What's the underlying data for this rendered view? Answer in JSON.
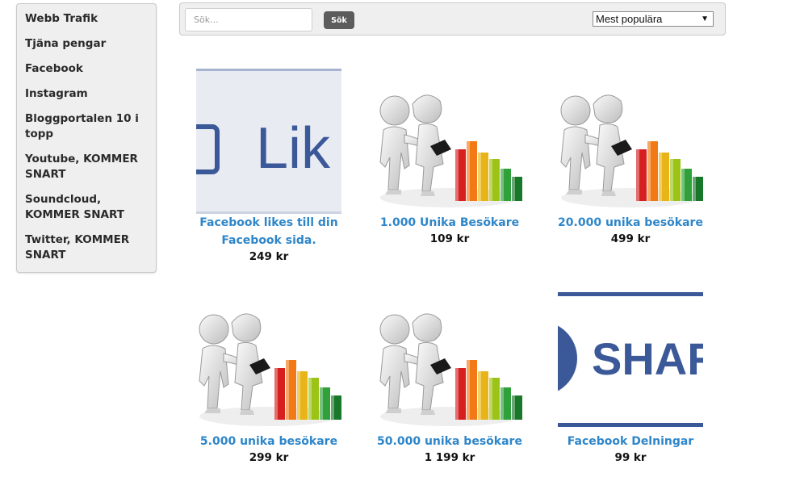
{
  "sidebar": {
    "items": [
      {
        "label": "Webb Trafik"
      },
      {
        "label": "Tjäna pengar"
      },
      {
        "label": "Facebook"
      },
      {
        "label": "Instagram"
      },
      {
        "label": "Bloggportalen 10 i topp"
      },
      {
        "label": "Youtube, KOMMER SNART"
      },
      {
        "label": "Soundcloud, KOMMER SNART"
      },
      {
        "label": "Twitter, KOMMER SNART"
      }
    ]
  },
  "search": {
    "placeholder": "Sök...",
    "value": "",
    "button_label": "Sök"
  },
  "sort": {
    "selected": "Mest populära"
  },
  "colors": {
    "link": "#2e86c9",
    "facebook_blue": "#3b5998",
    "button_dark": "#5c5c5c"
  },
  "products": [
    {
      "name": "Facebook likes till din Facebook sida.",
      "price": "249 kr",
      "image_text": "Lik",
      "image": "facebook-like-image"
    },
    {
      "name": "1.000 Unika Besökare",
      "price": "109 kr",
      "image": "visitors-chart-image"
    },
    {
      "name": "20.000 unika besökare",
      "price": "499 kr",
      "image": "visitors-chart-image"
    },
    {
      "name": "5.000 unika besökare",
      "price": "299 kr",
      "image": "visitors-chart-image"
    },
    {
      "name": "50.000 unika besökare",
      "price": "1 199 kr",
      "image": "visitors-chart-image"
    },
    {
      "name": "Facebook Delningar",
      "price": "99 kr",
      "image_text": "SHAR",
      "image": "facebook-share-image"
    }
  ]
}
